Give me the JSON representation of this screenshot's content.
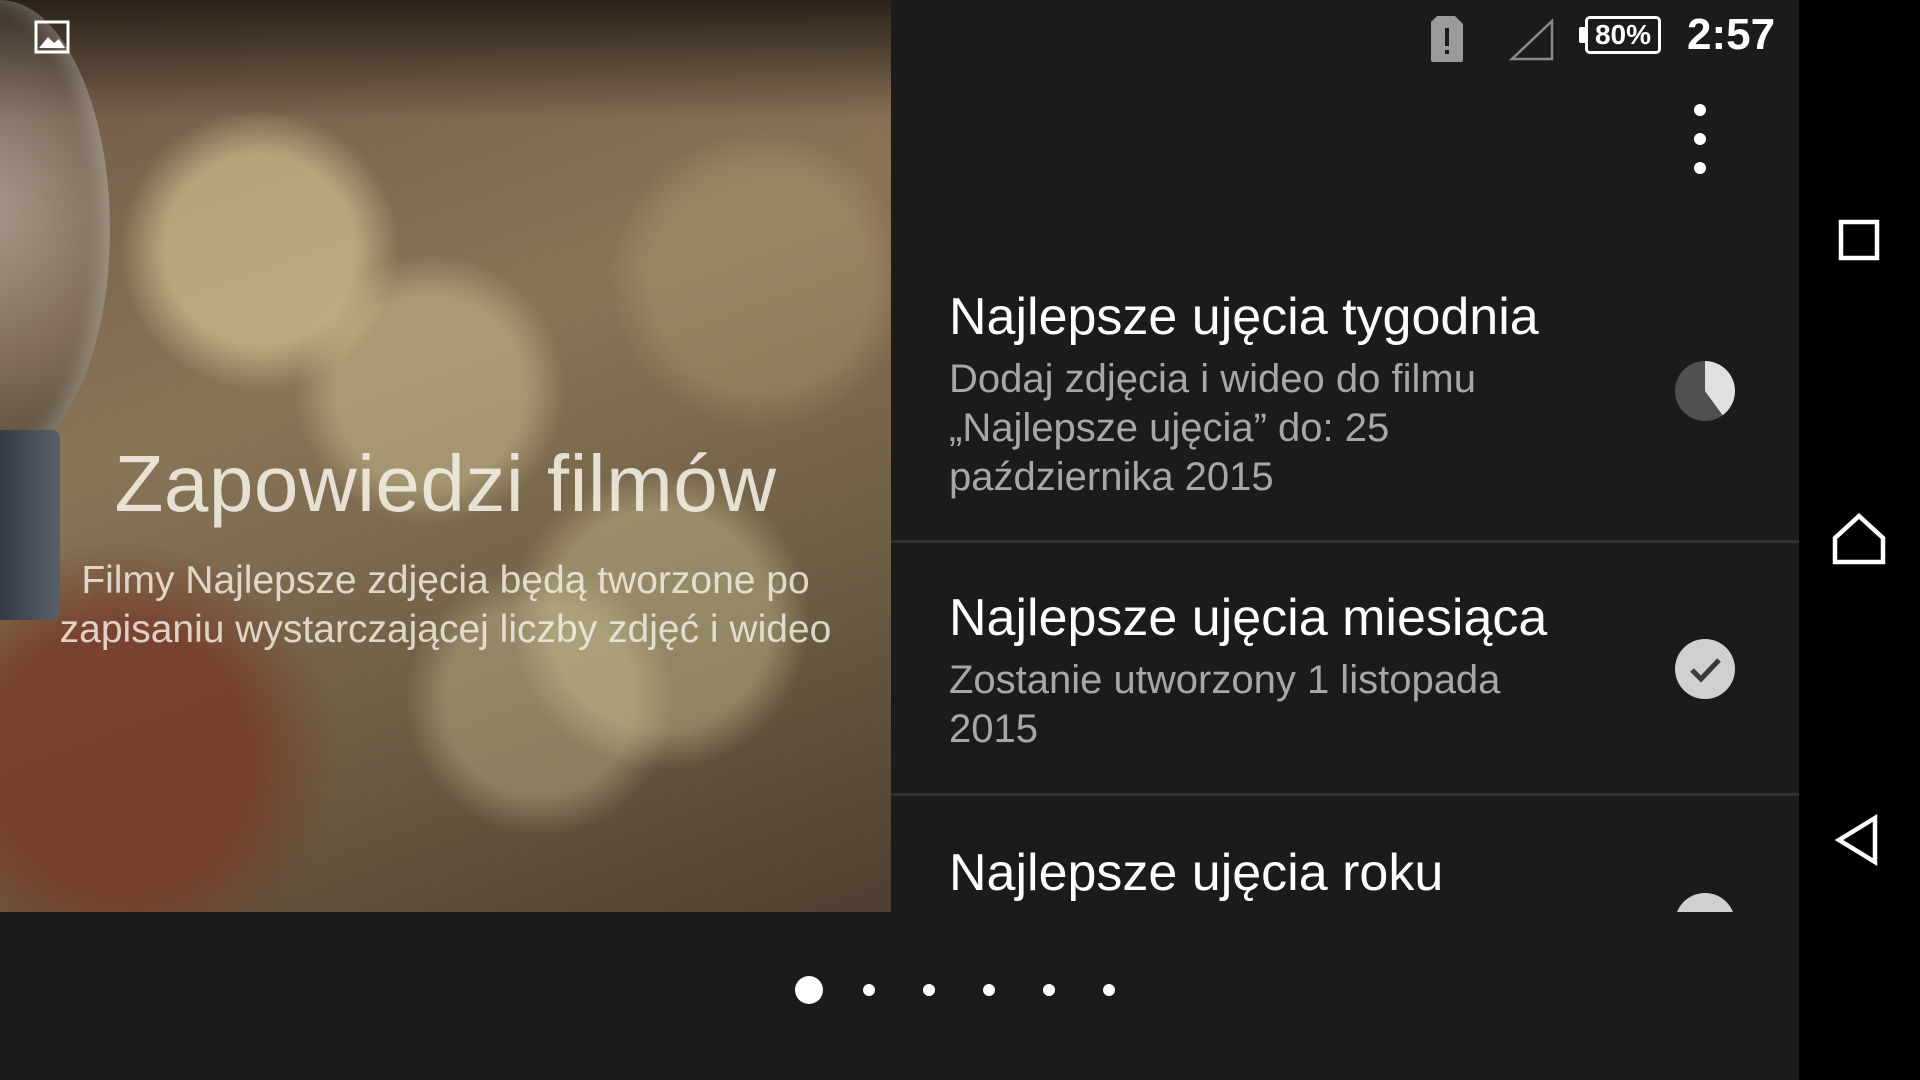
{
  "hero": {
    "title": "Zapowiedzi filmów",
    "subtitle": "Filmy Najlepsze zdjęcia będą tworzone po zapisaniu wystarczającej liczby zdjęć i wideo",
    "icon": "image-icon"
  },
  "status_bar": {
    "battery": "80%",
    "time": "2:57",
    "icons": [
      "sim-alert-icon",
      "signal-empty-icon",
      "battery-icon"
    ]
  },
  "menu": {
    "icon": "overflow-menu-icon"
  },
  "list": {
    "items": [
      {
        "title": "Najlepsze ujęcia tygodnia",
        "description": "Dodaj zdjęcia i wideo do filmu „Najlepsze ujęcia” do: 25 października 2015",
        "status_icon": "progress-pie-icon",
        "progress": 0.4
      },
      {
        "title": "Najlepsze ujęcia miesiąca",
        "description": "Zostanie utworzony 1 listopada 2015",
        "status_icon": "check-circle-icon"
      },
      {
        "title": "Najlepsze ujęcia roku",
        "description": "",
        "status_icon": "check-circle-icon"
      }
    ]
  },
  "navigation": {
    "buttons": [
      "recents-icon",
      "home-icon",
      "back-icon"
    ]
  },
  "pager": {
    "count": 6,
    "active": 1
  },
  "colors": {
    "background": "#1b1b1b",
    "navbar": "#000000",
    "secondary_text": "#a7a7a7",
    "divider": "#303030",
    "icon_gray": "#d0d0d0"
  }
}
